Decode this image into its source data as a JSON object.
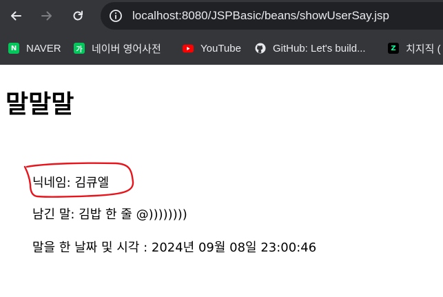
{
  "browser": {
    "url": "localhost:8080/JSPBasic/beans/showUserSay.jsp",
    "bookmarks": [
      {
        "label": "NAVER",
        "icon": "naver-icon",
        "icon_text": "N",
        "color": "#03c75a"
      },
      {
        "label": "네이버 영어사전",
        "icon": "naver-dictionary-icon",
        "icon_text": "가",
        "color": "#03c75a"
      },
      {
        "label": "YouTube",
        "icon": "youtube-icon",
        "color": "#ff0000"
      },
      {
        "label": "GitHub: Let's build...",
        "icon": "github-icon",
        "color": "#e8eaed"
      },
      {
        "label": "치지직 (",
        "icon": "chzzk-icon",
        "icon_text": "Z",
        "color": "#00ffa3"
      }
    ]
  },
  "page": {
    "title": "말말말",
    "nickname_line": "닉네임: 김큐엘",
    "message_line": "남긴 말: 김밥 한 줄 @))))))))",
    "datetime_line": "말을 한 날짜 및 시각 : 2024년 09월 08일 23:00:46"
  },
  "colors": {
    "chrome_bg": "#35363a",
    "omnibox_bg": "#202124",
    "annotation_red": "#e8141c"
  }
}
